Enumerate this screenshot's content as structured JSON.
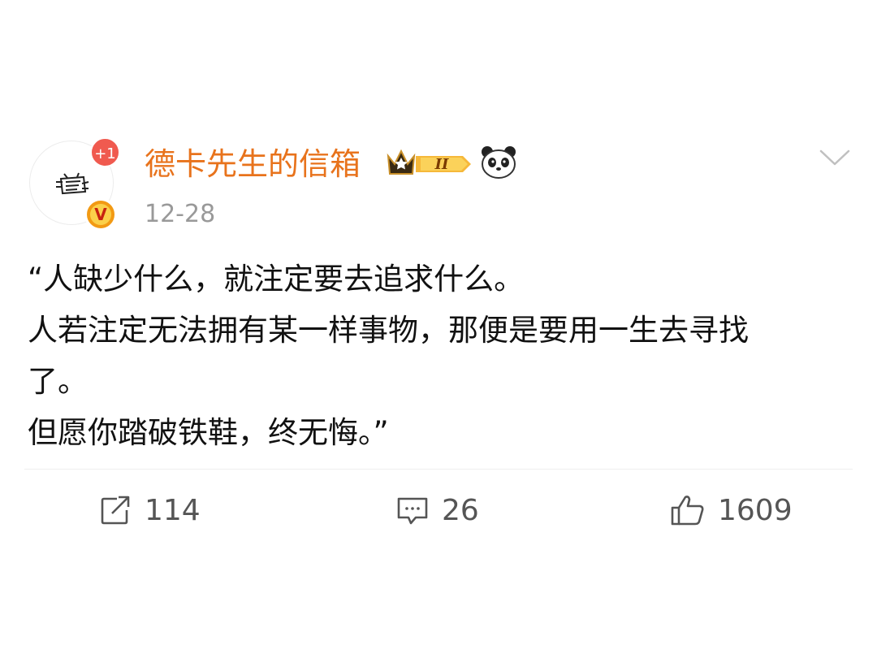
{
  "post": {
    "notification_badge": "+1",
    "verified_label": "V",
    "username": "德卡先生的信箱",
    "member_badge": "II",
    "date": "12-28",
    "content_lines": [
      "“人缺少什么，就注定要去追求什么。",
      "人若注定无法拥有某一样事物，那便是要用一生去寻找",
      "了。",
      "但愿你踏破铁鞋，终无悔。”"
    ]
  },
  "actions": {
    "repost_count": "114",
    "comment_count": "26",
    "like_count": "1609"
  },
  "colors": {
    "username": "#e8731c",
    "badge_red": "#f05a4f",
    "verified_orange": "#f29a14",
    "muted_text": "#999999",
    "action_text": "#555555"
  },
  "icons": [
    "avatar-sketch",
    "crown-icon",
    "panda-emoji",
    "chevron-down-icon",
    "repost-icon",
    "comment-icon",
    "like-icon"
  ]
}
